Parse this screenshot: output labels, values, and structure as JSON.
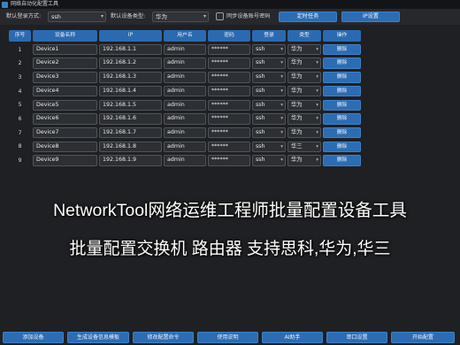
{
  "window": {
    "title": "网络自动化配置工具"
  },
  "toolbar": {
    "login_label": "默认登录方式:",
    "login_value": "ssh",
    "device_type_label": "默认设备类型:",
    "device_type_value": "华为",
    "sync_password_label": "同步设备账号密码",
    "timer_button": "定时任务",
    "ip_button": "IP设置"
  },
  "table": {
    "headers": [
      "序号",
      "设备名称",
      "IP",
      "用户名",
      "密码",
      "登录",
      "类型",
      "操作"
    ],
    "rows": [
      {
        "num": "1",
        "name": "Device1",
        "ip": "192.168.1.1",
        "user": "admin",
        "password": "******",
        "login": "ssh",
        "type": "华为",
        "action": "删除"
      },
      {
        "num": "2",
        "name": "Device2",
        "ip": "192.168.1.2",
        "user": "admin",
        "password": "******",
        "login": "ssh",
        "type": "华为",
        "action": "删除"
      },
      {
        "num": "3",
        "name": "Device3",
        "ip": "192.168.1.3",
        "user": "admin",
        "password": "******",
        "login": "ssh",
        "type": "华为",
        "action": "删除"
      },
      {
        "num": "4",
        "name": "Device4",
        "ip": "192.168.1.4",
        "user": "admin",
        "password": "******",
        "login": "ssh",
        "type": "华为",
        "action": "删除"
      },
      {
        "num": "5",
        "name": "Device5",
        "ip": "192.168.1.5",
        "user": "admin",
        "password": "******",
        "login": "ssh",
        "type": "华为",
        "action": "删除"
      },
      {
        "num": "6",
        "name": "Device6",
        "ip": "192.168.1.6",
        "user": "admin",
        "password": "******",
        "login": "ssh",
        "type": "华为",
        "action": "删除"
      },
      {
        "num": "7",
        "name": "Device7",
        "ip": "192.168.1.7",
        "user": "admin",
        "password": "******",
        "login": "ssh",
        "type": "华为",
        "action": "删除"
      },
      {
        "num": "8",
        "name": "Device8",
        "ip": "192.168.1.8",
        "user": "admin",
        "password": "******",
        "login": "ssh",
        "type": "华三",
        "action": "删除"
      },
      {
        "num": "9",
        "name": "Device9",
        "ip": "192.168.1.9",
        "user": "admin",
        "password": "******",
        "login": "ssh",
        "type": "华为",
        "action": "删除"
      }
    ]
  },
  "overlay": {
    "line1": "NetworkTool网络运维工程师批量配置设备工具",
    "line2": "批量配置交换机 路由器 支持思科,华为,华三"
  },
  "bottom_buttons": [
    "添加设备",
    "生成设备信息模板",
    "修改配置命令",
    "使用说明",
    "AI助手",
    "串口设置",
    "开始配置"
  ]
}
